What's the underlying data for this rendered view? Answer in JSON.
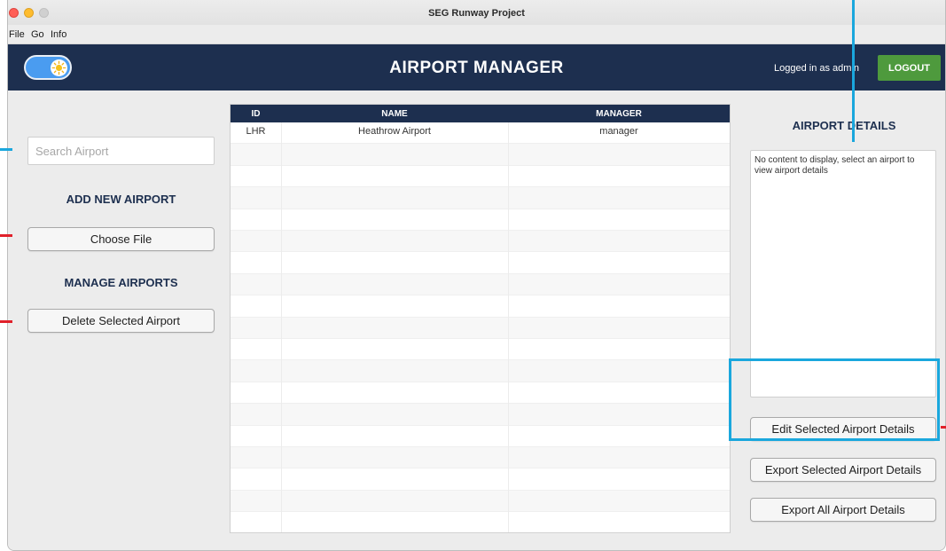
{
  "window": {
    "title": "SEG Runway Project"
  },
  "menu": {
    "items": [
      "File",
      "Go",
      "Info"
    ]
  },
  "header": {
    "title": "AIRPORT MANAGER",
    "logged_in_text": "Logged in as admin",
    "logout_label": "LOGOUT",
    "colors": {
      "header_bg": "#1d2f4f",
      "logout_bg": "#4e9a3d",
      "toggle_bg": "#4a9cf0"
    }
  },
  "sidebar": {
    "search_placeholder": "Search Airport",
    "add_heading": "ADD NEW AIRPORT",
    "choose_file_label": "Choose File",
    "manage_heading": "MANAGE AIRPORTS",
    "delete_label": "Delete Selected Airport"
  },
  "table": {
    "columns": [
      "ID",
      "NAME",
      "MANAGER"
    ],
    "rows": [
      {
        "id": "LHR",
        "name": "Heathrow Airport",
        "manager": "manager"
      }
    ]
  },
  "details": {
    "title": "AIRPORT DETAILS",
    "empty_text": "No content to display, select an airport to view airport details",
    "edit_label": "Edit Selected Airport Details",
    "export_selected_label": "Export Selected Airport Details",
    "export_all_label": "Export All Airport Details"
  }
}
